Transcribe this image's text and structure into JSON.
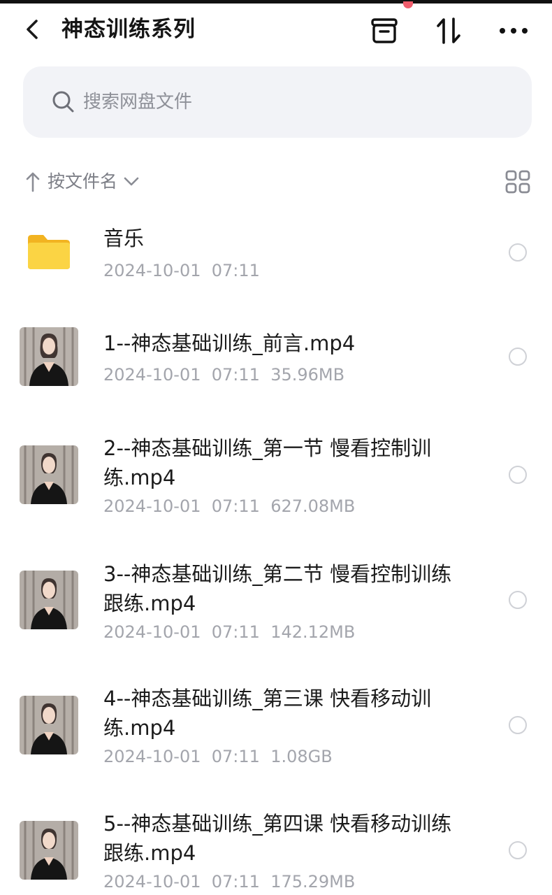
{
  "header": {
    "title": "神态训练系列",
    "back_icon": "chevron-left-icon",
    "archive_icon": "archive-box-icon",
    "sort_icon": "sort-updown-icon",
    "more_icon": "more-dots-icon"
  },
  "search": {
    "placeholder": "搜索网盘文件",
    "value": ""
  },
  "sortbar": {
    "label": "按文件名",
    "direction_icon": "arrow-up-icon",
    "dropdown_icon": "chevron-down-icon",
    "view_toggle_icon": "grid-view-icon"
  },
  "files": [
    {
      "type": "folder",
      "name": "音乐",
      "date": "2024-10-01",
      "time": "07:11",
      "size": ""
    },
    {
      "type": "video",
      "name": "1--神态基础训练_前言.mp4",
      "date": "2024-10-01",
      "time": "07:11",
      "size": "35.96MB"
    },
    {
      "type": "video",
      "name": "2--神态基础训练_第一节 慢看控制训练.mp4",
      "date": "2024-10-01",
      "time": "07:11",
      "size": "627.08MB"
    },
    {
      "type": "video",
      "name": "3--神态基础训练_第二节 慢看控制训练 跟练.mp4",
      "date": "2024-10-01",
      "time": "07:11",
      "size": "142.12MB"
    },
    {
      "type": "video",
      "name": "4--神态基础训练_第三课 快看移动训练.mp4",
      "date": "2024-10-01",
      "time": "07:11",
      "size": "1.08GB"
    },
    {
      "type": "video",
      "name": "5--神态基础训练_第四课 快看移动训练 跟练.mp4",
      "date": "2024-10-01",
      "time": "07:11",
      "size": "175.29MB"
    }
  ],
  "colors": {
    "accent_dot": "#f05d6c",
    "search_bg": "#f2f3f7",
    "folder_yellow": "#f9c93a",
    "meta_gray": "#a3a5ac"
  }
}
